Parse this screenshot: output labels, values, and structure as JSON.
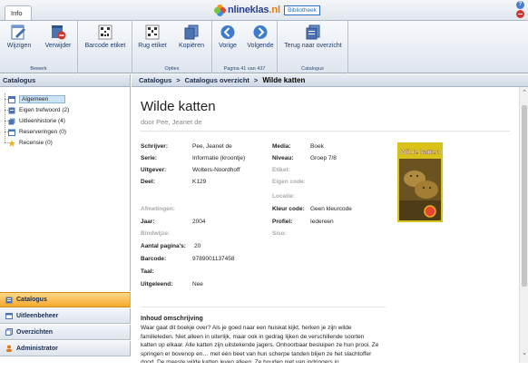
{
  "app": {
    "info_tab": "Info",
    "logo_part1": "nlineklas",
    "logo_part2": ".nl",
    "logo_badge": "Bibliotheek",
    "help_glyph": "?"
  },
  "ribbon": {
    "groups": [
      {
        "label": "Bewerk"
      },
      {
        "label": "Opties"
      },
      {
        "label": "Pagina 41 van 437"
      },
      {
        "label": "Catalogus"
      }
    ],
    "buttons": {
      "wijzigen": "Wijzigen",
      "verwijder": "Verwijder",
      "barcode_etiket": "Barcode etiket",
      "rug_etiket": "Rug etiket",
      "kopieren": "Kopiëren",
      "vorige": "Vorige",
      "volgende": "Volgende",
      "terug": "Terug naar overzicht"
    }
  },
  "left_panel": {
    "title": "Catalogus",
    "tree": [
      {
        "label": "Algemeen",
        "icon": "list-icon",
        "selected": true
      },
      {
        "label": "Eigen trefwoord (2)",
        "icon": "tag-icon",
        "selected": false
      },
      {
        "label": "Uitleenhistorie (4)",
        "icon": "history-icon",
        "selected": false
      },
      {
        "label": "Reserveringen (0)",
        "icon": "calendar-icon",
        "selected": false
      },
      {
        "label": "Recensie (0)",
        "icon": "star-icon",
        "selected": false
      }
    ],
    "nav": {
      "catalogus": "Catalogus",
      "uitleenbeheer": "Uitleenbeheer",
      "overzichten": "Overzichten",
      "administrator": "Administrator"
    }
  },
  "breadcrumb": {
    "item1": "Catalogus",
    "item2": "Catalogus overzicht",
    "item3": "Wilde katten",
    "sep": ">"
  },
  "book": {
    "title": "Wilde katten",
    "author_line": "door Pee, Jeanet de",
    "cover_title": "Wilde katten",
    "fields_left": [
      {
        "label": "Schrijver:",
        "value": "Pee, Jeanet de",
        "muted": false
      },
      {
        "label": "Serie:",
        "value": "Informatie (kroontje)",
        "muted": false
      },
      {
        "label": "Uitgever:",
        "value": "Wolters-Noordhoff",
        "muted": false
      },
      {
        "label": "Deel:",
        "value": "K129",
        "muted": false
      },
      {
        "label": "Afmetingen:",
        "value": "",
        "muted": true
      },
      {
        "label": "Jaar:",
        "value": "2004",
        "muted": false
      },
      {
        "label": "Bindwijze:",
        "value": "",
        "muted": true
      },
      {
        "label": "Aantal pagina's:",
        "value": "20",
        "muted": false
      },
      {
        "label": "Barcode:",
        "value": "9789001137458",
        "muted": false
      },
      {
        "label": "Taal:",
        "value": "",
        "muted": false
      },
      {
        "label": "Uitgeleend:",
        "value": "Nee",
        "muted": false
      }
    ],
    "fields_right": [
      {
        "label": "Media:",
        "value": "Boek",
        "muted": false
      },
      {
        "label": "Niveau:",
        "value": "Groep 7/8",
        "muted": false
      },
      {
        "label": "Etiket:",
        "value": "",
        "muted": true
      },
      {
        "label": "Eigen code:",
        "value": "",
        "muted": true
      },
      {
        "label": "Locatie:",
        "value": "",
        "muted": true
      },
      {
        "label": "Kleur code:",
        "value": "Geen kleurcode",
        "muted": false
      },
      {
        "label": "Profiel:",
        "value": "Iedereen",
        "muted": false
      },
      {
        "label": "Siso:",
        "value": "",
        "muted": true
      }
    ],
    "description_title": "Inhoud omschrijving",
    "description": "Waar gaat dit boekje over? Als je goed naar een huiskat kijkt, herken je zijn wilde familieleden. Niet alleen in uiterlijk, maar ook in gedrag lijken de verschillende soorten katten op elkaar. Alle katten zijn uitstekende jagers. Onhoorbaar besluipen ze hun prooi. Ze springen er bovenop en… met één beet van hun scherpe tanden blijen ze het slachtoffer dood. De meeste wilde katten leven alleen. Ze houden niet van indringers in"
  },
  "colors": {
    "accent_orange": "#f6a92c",
    "ribbon_blue": "#1f3c6e",
    "cover_border": "#d9c21a"
  }
}
